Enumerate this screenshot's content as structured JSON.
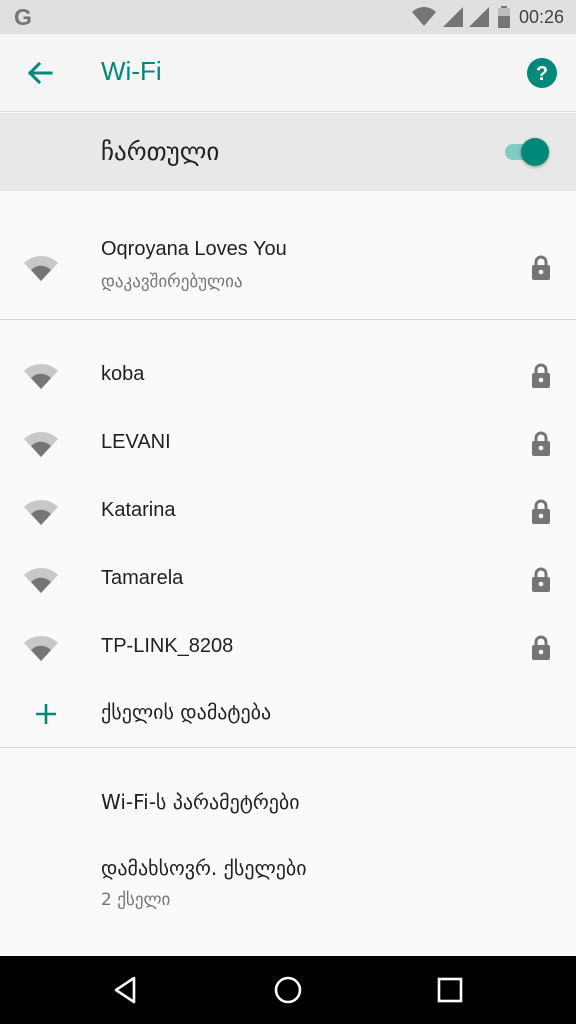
{
  "status_bar": {
    "carrier_logo": "G",
    "time": "00:26",
    "icons": [
      "wifi-signal-icon",
      "cell-signal-icon",
      "cell-signal-icon",
      "battery-icon"
    ]
  },
  "app_bar": {
    "title": "Wi-Fi",
    "back_icon": "arrow-back-icon",
    "help_icon": "help-icon"
  },
  "master_switch": {
    "label": "ჩართული",
    "state": "on"
  },
  "connected_network": {
    "ssid": "Oqroyana Loves You",
    "status": "დაკავშირებულია",
    "secured": true
  },
  "networks": [
    {
      "ssid": "koba",
      "secured": true
    },
    {
      "ssid": "LEVANI",
      "secured": true
    },
    {
      "ssid": "Katarina",
      "secured": true
    },
    {
      "ssid": "Tamarela",
      "secured": true
    },
    {
      "ssid": "TP-LINK_8208",
      "secured": true
    }
  ],
  "add_network": {
    "label": "ქსელის დამატება"
  },
  "wifi_preferences": {
    "label": "Wi-Fi-ს პარამეტრები"
  },
  "saved_networks": {
    "label": "დამახსოვრ. ქსელები",
    "count_text": "2 ქსელი"
  },
  "colors": {
    "accent": "#00897b",
    "accent_light": "#80cbc4",
    "icon_gray": "#757575"
  },
  "nav_bar": [
    "back-triangle-icon",
    "home-circle-icon",
    "recents-square-icon"
  ]
}
